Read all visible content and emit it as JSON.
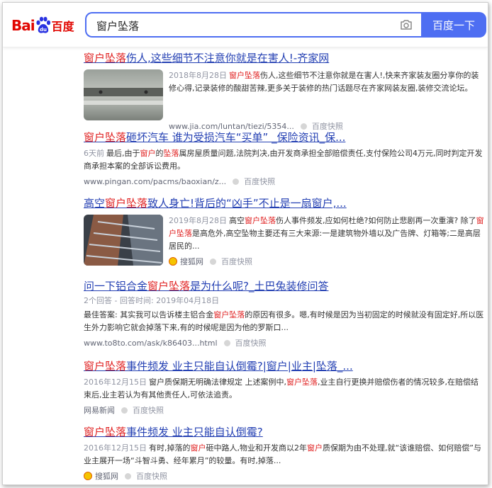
{
  "logo": {
    "left": "Bai",
    "right": "百度"
  },
  "search": {
    "query": "窗户坠落",
    "button": "百度一下"
  },
  "results": [
    {
      "title_pre": "",
      "title_em": "窗户坠落",
      "title_post": "伤人,这些细节不注意你就是在害人!-齐家网",
      "date": "2018年8月28日",
      "abs_pre": "",
      "abs_em": "窗户坠落",
      "abs_post": "伤人,这些细节不注意你就是在害人!,快来齐家装友圈分享你的装修心得,记录装修的酸甜苦辣,更多关于装修的热门话题尽在齐家网装友圈,装修交流论坛。",
      "source": "www.jia.com/luntan/tiezi/5354...",
      "kuaizhao": "百度快照"
    },
    {
      "title_pre": "",
      "title_em": "窗户坠落",
      "title_post": "砸坏汽车 谁为受损汽车“买单” _保险资讯_保...",
      "date": "6天前",
      "abs_a": "最后,由于",
      "abs_em1": "窗户",
      "abs_b": "的",
      "abs_em2": "坠落",
      "abs_c": "属房屋质量问题,法院判决,由开发商承担全部赔偿责任,支付保险公司4万元,同时判定开发商承担本案的全部诉讼费用。",
      "source": "www.pingan.com/pacms/baoxian/z...",
      "kuaizhao": "百度快照"
    },
    {
      "title_pre": "高空",
      "title_em": "窗户坠落",
      "title_post": "致人身亡!背后的“凶手”不止是一扇窗户,...",
      "date": "2019年8月28日",
      "abs_a": "高空",
      "abs_em1": "窗户坠落",
      "abs_b": "伤人事件频发,应如何杜绝?如何防止悲剧再一次重演? 除了",
      "abs_em2": "窗户坠落",
      "abs_c": "是高危外,高空坠物主要还有三大来源:一是建筑物外墙以及广告牌、灯箱等;二是高层居民的...",
      "source": "搜狐网",
      "kuaizhao": "百度快照"
    },
    {
      "title_pre": "问一下铝合金",
      "title_em": "窗户坠落",
      "title_post": "是为什么呢?_土巴兔装修问答",
      "meta": "2个回答 - 回答时间: 2019年04月18日",
      "abs_a": "最佳答案: 其实我可以告诉楼主铝合金",
      "abs_em1": "窗户坠落",
      "abs_b": "的原因有很多。嗯,有时候是因为当初固定的时候就没有固定好,所以医生外力影响它就会掉落下来,有的时候呢是因为他的罗斯口...",
      "source": "www.to8to.com/ask/k86403...html",
      "kuaizhao": "百度快照"
    },
    {
      "title_pre": "",
      "title_em": "窗户坠落",
      "title_post": "事件频发 业主只能自认倒霉?|窗户|业主|坠落_...",
      "date": "2016年12月15日",
      "abs_a": "窗户质保期无明确法律规定 上述案例中,",
      "abs_em1": "窗户坠落",
      "abs_b": ",业主自行更换并赔偿伤者的情况较多,在赔偿结束后,业主若认为有其他责任人,可依法追责。",
      "source": "网易新闻",
      "kuaizhao": "百度快照"
    },
    {
      "title_pre": "",
      "title_em": "窗户坠落",
      "title_post": "事件频发 业主只能自认倒霉?",
      "date": "2016年12月15日",
      "abs_a": "有时,掉落的",
      "abs_em1": "窗户",
      "abs_b": "砸中路人,物业和开发商以2年",
      "abs_em2": "窗户",
      "abs_c": "质保期为由不处理,就“该谁赔偿、如何赔偿”与业主展开一场“斗智斗勇、经年累月”的较量。有时,掉落...",
      "source": "搜狐网",
      "kuaizhao": "百度快照"
    }
  ],
  "icons": [
    "baidu-paw-icon",
    "camera-icon",
    "snapshot-circle-icon",
    "sohu-icon"
  ],
  "colors": {
    "brand_red": "#e10601",
    "brand_blue": "#4e6ef2",
    "link": "#2440b3",
    "highlight": "#e02020"
  }
}
